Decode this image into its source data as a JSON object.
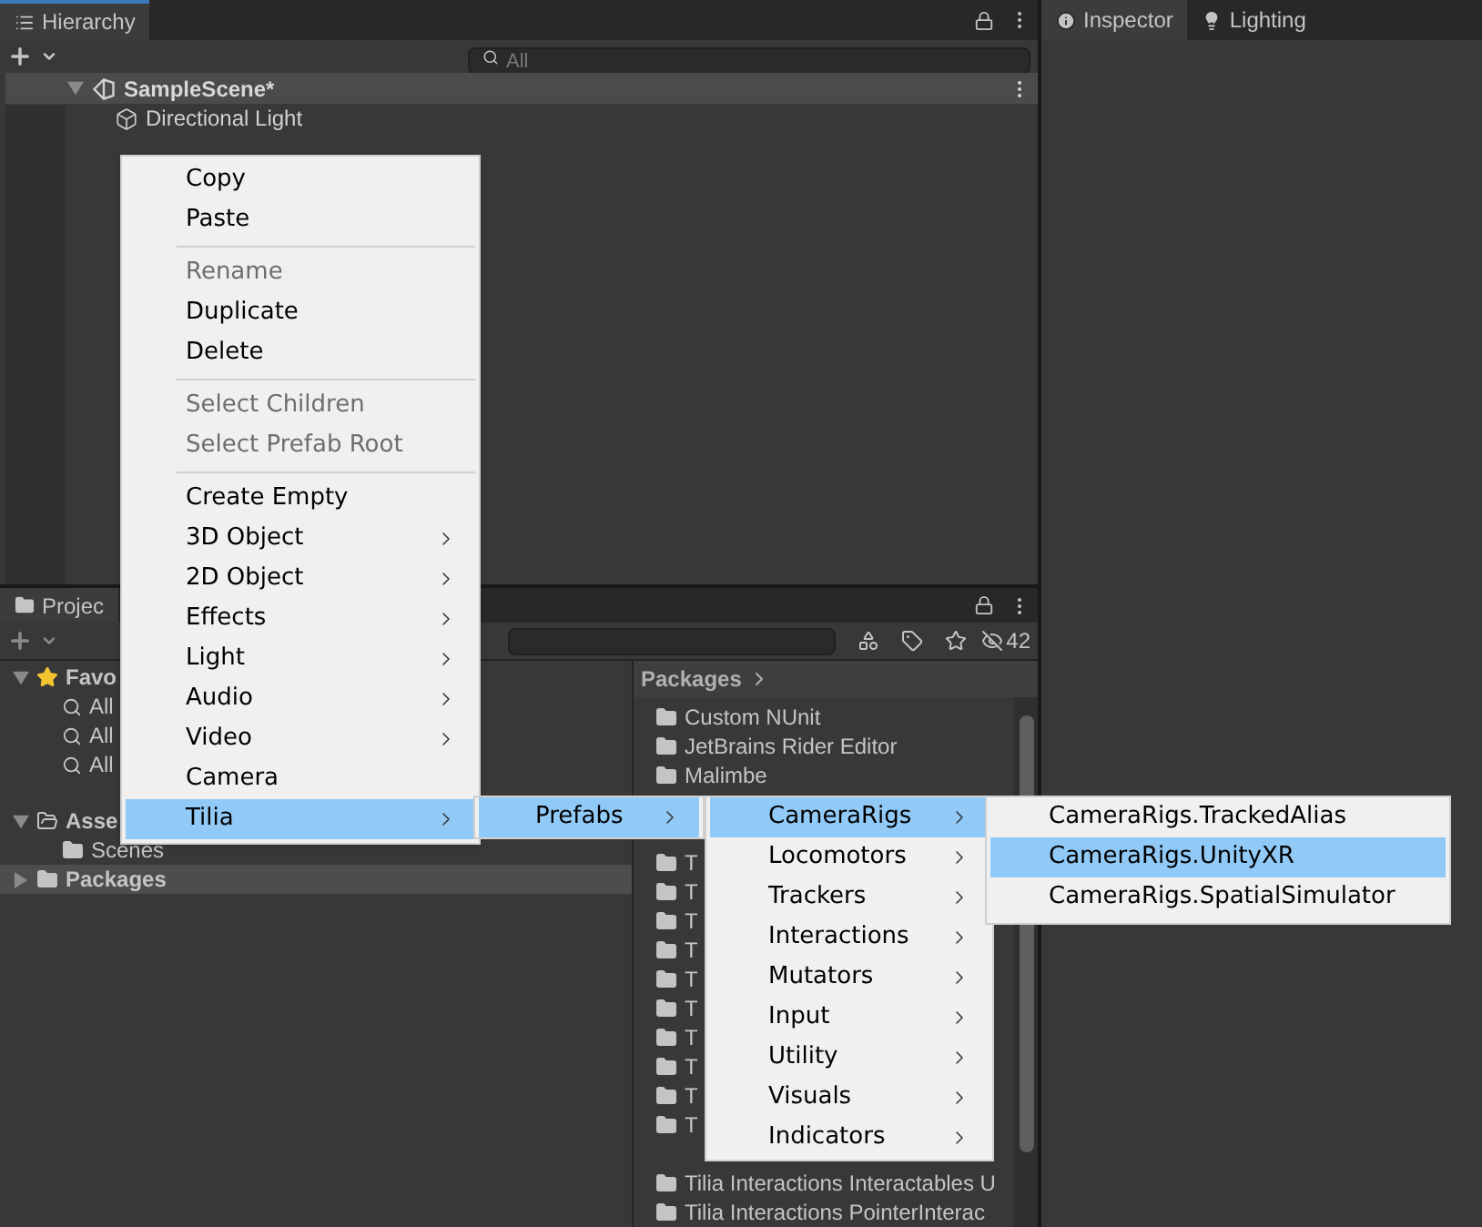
{
  "hierarchy": {
    "tab": "Hierarchy",
    "search": {
      "placeholder": "All"
    },
    "scene": "SampleScene*",
    "objects": [
      "Directional Light"
    ]
  },
  "inspector_tabs": [
    {
      "label": "Inspector",
      "selected": true,
      "kind": "info"
    },
    {
      "label": "Lighting",
      "selected": false,
      "kind": "bulb"
    }
  ],
  "project": {
    "tab": "Projec",
    "hidden_count": "42",
    "tree": [
      {
        "label": "Favo",
        "kind": "favorites",
        "expanded": true,
        "selected": false,
        "children": [
          {
            "label": "All",
            "kind": "search",
            "selected": false
          },
          {
            "label": "All",
            "kind": "search",
            "selected": false
          },
          {
            "label": "All",
            "kind": "search",
            "selected": false
          }
        ]
      },
      {
        "label": "Asse",
        "kind": "folder-open",
        "expanded": true,
        "selected": false,
        "children": [
          {
            "label": "Scenes",
            "kind": "folder",
            "selected": false
          }
        ]
      },
      {
        "label": "Packages",
        "kind": "folder",
        "expanded": false,
        "selected": true
      }
    ],
    "breadcrumb": "Packages",
    "files": [
      "Custom NUnit",
      "JetBrains Rider Editor",
      "Malimbe",
      "T",
      "T",
      "T",
      "T",
      "T",
      "T",
      "T",
      "T",
      "T",
      "T",
      "Tilia Interactions Interactables U",
      "Tilia Interactions PointerInterac"
    ]
  },
  "context_menu": {
    "groups": [
      [
        {
          "label": "Copy",
          "disabled": false,
          "submenu": false,
          "selected": false
        },
        {
          "label": "Paste",
          "disabled": false,
          "submenu": false,
          "selected": false
        }
      ],
      [
        {
          "label": "Rename",
          "disabled": true,
          "submenu": false,
          "selected": false
        },
        {
          "label": "Duplicate",
          "disabled": false,
          "submenu": false,
          "selected": false
        },
        {
          "label": "Delete",
          "disabled": false,
          "submenu": false,
          "selected": false
        }
      ],
      [
        {
          "label": "Select Children",
          "disabled": true,
          "submenu": false,
          "selected": false
        },
        {
          "label": "Select Prefab Root",
          "disabled": true,
          "submenu": false,
          "selected": false
        }
      ],
      [
        {
          "label": "Create Empty",
          "disabled": false,
          "submenu": false,
          "selected": false
        },
        {
          "label": "3D Object",
          "disabled": false,
          "submenu": true,
          "selected": false
        },
        {
          "label": "2D Object",
          "disabled": false,
          "submenu": true,
          "selected": false
        },
        {
          "label": "Effects",
          "disabled": false,
          "submenu": true,
          "selected": false
        },
        {
          "label": "Light",
          "disabled": false,
          "submenu": true,
          "selected": false
        },
        {
          "label": "Audio",
          "disabled": false,
          "submenu": true,
          "selected": false
        },
        {
          "label": "Video",
          "disabled": false,
          "submenu": true,
          "selected": false
        },
        {
          "label": "Camera",
          "disabled": false,
          "submenu": false,
          "selected": false
        },
        {
          "label": "Tilia",
          "disabled": false,
          "submenu": true,
          "selected": true
        }
      ]
    ]
  },
  "tilia_menu": [
    {
      "label": "Prefabs",
      "submenu": true,
      "selected": true
    }
  ],
  "prefabs_menu": [
    {
      "label": "CameraRigs",
      "submenu": true,
      "selected": true
    },
    {
      "label": "Locomotors",
      "submenu": true,
      "selected": false
    },
    {
      "label": "Trackers",
      "submenu": true,
      "selected": false
    },
    {
      "label": "Interactions",
      "submenu": true,
      "selected": false
    },
    {
      "label": "Mutators",
      "submenu": true,
      "selected": false
    },
    {
      "label": "Input",
      "submenu": true,
      "selected": false
    },
    {
      "label": "Utility",
      "submenu": true,
      "selected": false
    },
    {
      "label": "Visuals",
      "submenu": true,
      "selected": false
    },
    {
      "label": "Indicators",
      "submenu": true,
      "selected": false
    }
  ],
  "camerarigs_menu": [
    {
      "label": "CameraRigs.TrackedAlias",
      "submenu": false,
      "selected": false
    },
    {
      "label": "CameraRigs.UnityXR",
      "submenu": false,
      "selected": true
    },
    {
      "label": "CameraRigs.SpatialSimulator",
      "submenu": false,
      "selected": false
    }
  ]
}
